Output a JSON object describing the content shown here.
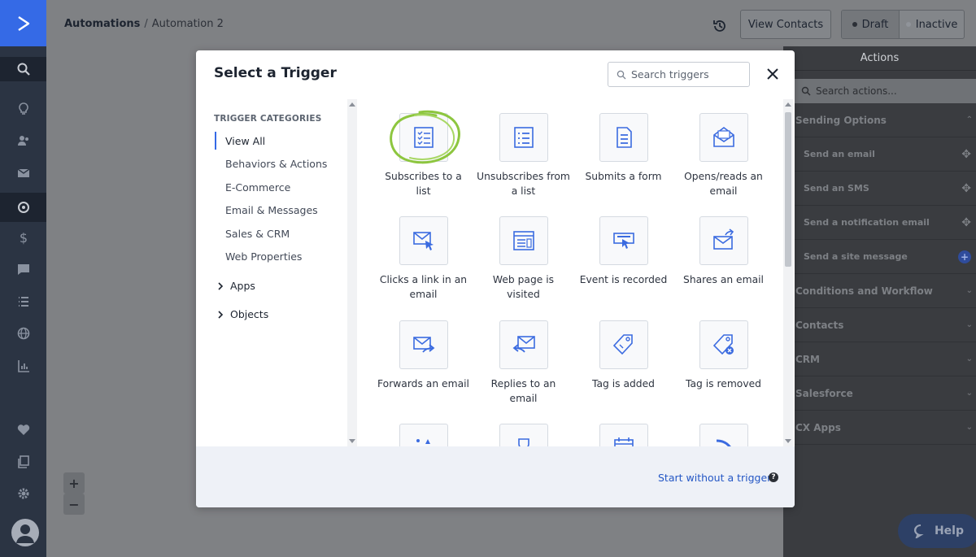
{
  "header": {
    "breadcrumb_root": "Automations",
    "breadcrumb_sep": "/",
    "breadcrumb_current": "Automation 2",
    "view_contacts": "View Contacts",
    "status_draft": "Draft",
    "status_inactive": "Inactive"
  },
  "actions_panel": {
    "title": "Actions",
    "search_placeholder": "Search actions...",
    "sections": {
      "sending": "Sending Options",
      "conditions": "Conditions and Workflow",
      "contacts": "Contacts",
      "crm": "CRM",
      "salesforce": "Salesforce",
      "cx": "CX Apps"
    },
    "items": {
      "email": "Send an email",
      "sms": "Send an SMS",
      "notification": "Send a notification email",
      "site": "Send a site message"
    }
  },
  "zoom": {
    "in": "+",
    "out": "−"
  },
  "help": {
    "label": "Help"
  },
  "modal": {
    "title": "Select a Trigger",
    "search_placeholder": "Search triggers",
    "categories_heading": "TRIGGER CATEGORIES",
    "categories": [
      "View All",
      "Behaviors & Actions",
      "E-Commerce",
      "Email & Messages",
      "Sales & CRM",
      "Web Properties"
    ],
    "groups": [
      "Apps",
      "Objects"
    ],
    "triggers": [
      "Subscribes to a list",
      "Unsubscribes from a list",
      "Submits a form",
      "Opens/reads an email",
      "Clicks a link in an email",
      "Web page is visited",
      "Event is recorded",
      "Shares an email",
      "Forwards an email",
      "Replies to an email",
      "Tag is added",
      "Tag is removed"
    ],
    "start_without": "Start without a trigger",
    "help_glyph": "?"
  },
  "colors": {
    "accent": "#356ae6",
    "nav_bg": "#2b3443",
    "link": "#2457c5",
    "highlight_circle": "#8dc63f"
  }
}
